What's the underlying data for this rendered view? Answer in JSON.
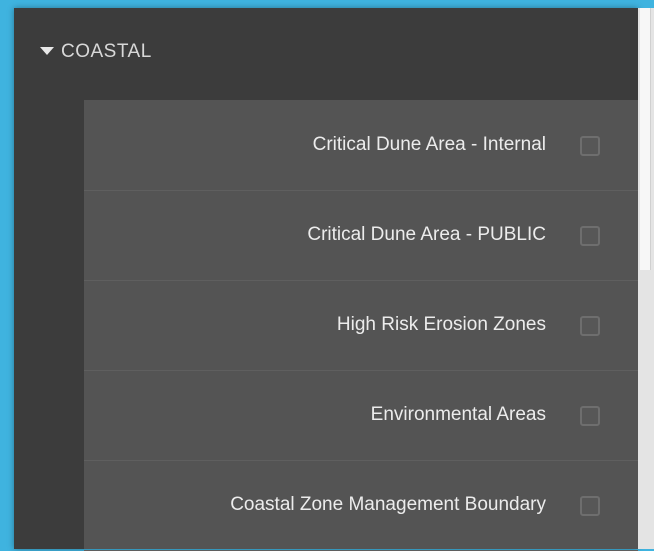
{
  "layer_panel": {
    "group": {
      "label": "COASTAL",
      "expanded": true,
      "icon": "caret-down-icon"
    },
    "layers": [
      {
        "label": "Critical Dune Area - Internal",
        "checked": false
      },
      {
        "label": "Critical Dune Area - PUBLIC",
        "checked": false
      },
      {
        "label": "High Risk Erosion Zones",
        "checked": false
      },
      {
        "label": "Environmental Areas",
        "checked": false
      },
      {
        "label": "Coastal Zone Management Boundary",
        "checked": false
      }
    ]
  },
  "colors": {
    "background": "#3fb3df",
    "panel": "#3c3c3c",
    "list": "#545454",
    "text": "#ececec"
  }
}
